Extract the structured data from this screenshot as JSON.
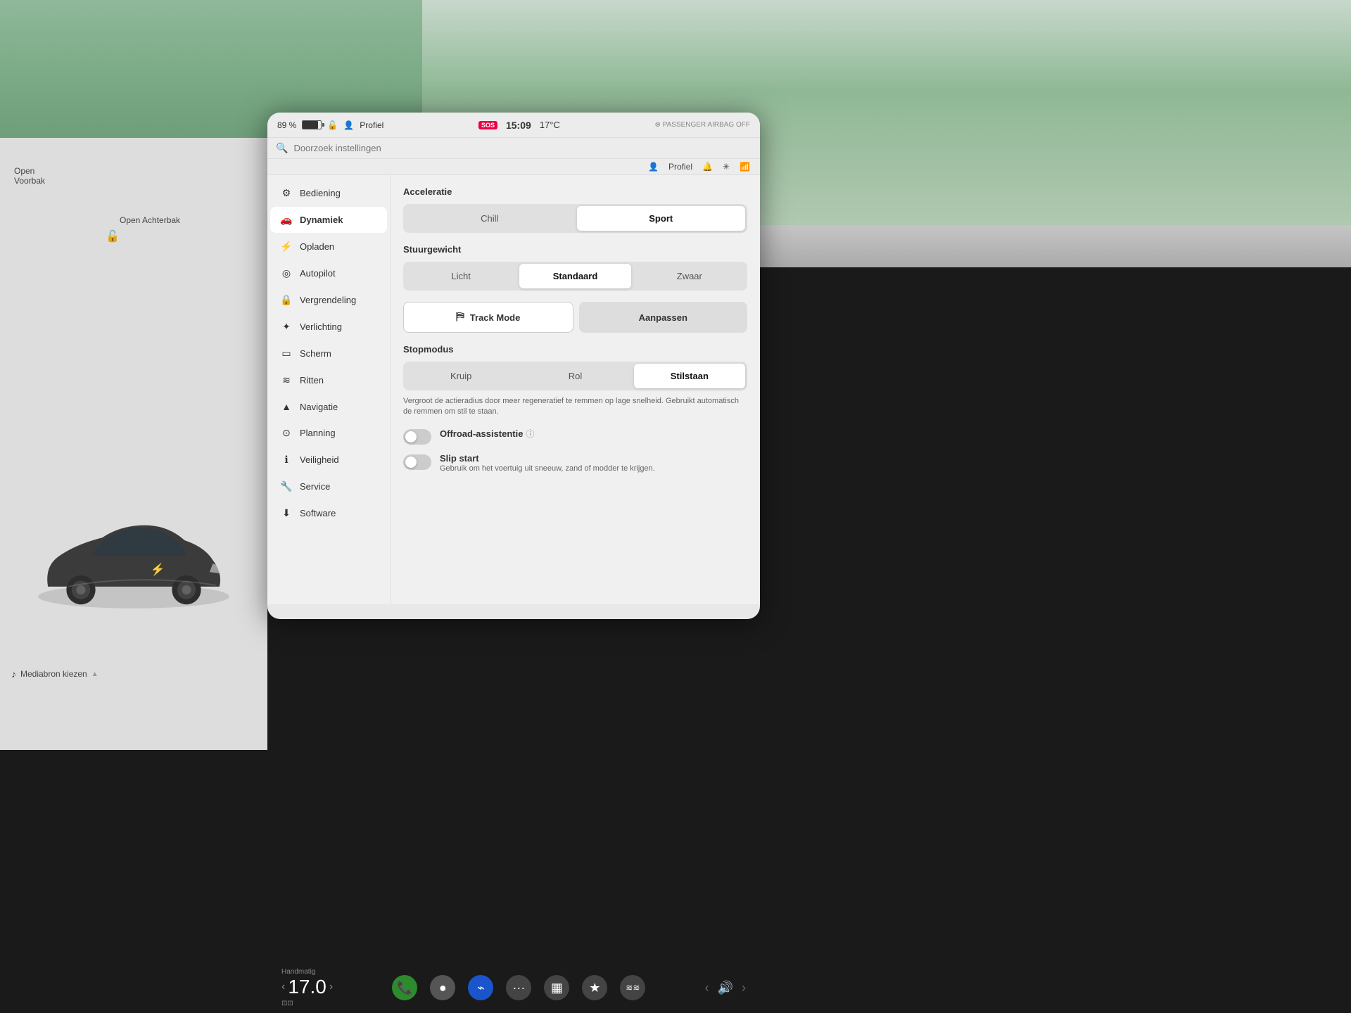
{
  "background": {
    "color": "#8fb89a"
  },
  "status_bar": {
    "battery_percent": "89 %",
    "profile_label": "Profiel",
    "sos_label": "SOS",
    "time": "15:09",
    "temperature": "17°C"
  },
  "search": {
    "placeholder": "Doorzoek instellingen"
  },
  "profile_bar": {
    "profile_label": "Profiel"
  },
  "sidebar": {
    "items": [
      {
        "id": "bediening",
        "label": "Bediening",
        "icon": "⚙"
      },
      {
        "id": "dynamiek",
        "label": "Dynamiek",
        "icon": "🚗",
        "active": true
      },
      {
        "id": "opladen",
        "label": "Opladen",
        "icon": "⚡"
      },
      {
        "id": "autopilot",
        "label": "Autopilot",
        "icon": "◎"
      },
      {
        "id": "vergrendeling",
        "label": "Vergrendeling",
        "icon": "🔒"
      },
      {
        "id": "verlichting",
        "label": "Verlichting",
        "icon": "✦"
      },
      {
        "id": "scherm",
        "label": "Scherm",
        "icon": "▭"
      },
      {
        "id": "ritten",
        "label": "Ritten",
        "icon": "≋"
      },
      {
        "id": "navigatie",
        "label": "Navigatie",
        "icon": "▲"
      },
      {
        "id": "planning",
        "label": "Planning",
        "icon": "⊙"
      },
      {
        "id": "veiligheid",
        "label": "Veiligheid",
        "icon": "ℹ"
      },
      {
        "id": "service",
        "label": "Service",
        "icon": "🔧"
      },
      {
        "id": "software",
        "label": "Software",
        "icon": "⬇"
      }
    ]
  },
  "settings": {
    "acceleratie": {
      "title": "Acceleratie",
      "options": [
        {
          "id": "chill",
          "label": "Chill",
          "active": false
        },
        {
          "id": "sport",
          "label": "Sport",
          "active": true
        }
      ]
    },
    "stuurgewicht": {
      "title": "Stuurgewicht",
      "options": [
        {
          "id": "licht",
          "label": "Licht",
          "active": false
        },
        {
          "id": "standaard",
          "label": "Standaard",
          "active": true
        },
        {
          "id": "zwaar",
          "label": "Zwaar",
          "active": false
        }
      ]
    },
    "track_mode": {
      "label": "Track Mode",
      "adjust_label": "Aanpassen"
    },
    "stopmodus": {
      "title": "Stopmodus",
      "options": [
        {
          "id": "kruip",
          "label": "Kruip",
          "active": false
        },
        {
          "id": "rol",
          "label": "Rol",
          "active": false
        },
        {
          "id": "stilstaan",
          "label": "Stilstaan",
          "active": true
        }
      ],
      "description": "Vergroot de actieradius door meer regeneratief te remmen op lage snelheid. Gebruikt automatisch de remmen om stil te staan."
    },
    "offroad": {
      "label": "Offroad-assistentie",
      "enabled": false
    },
    "slip_start": {
      "label": "Slip start",
      "description": "Gebruik om het voertuig uit sneeuw, zand of modder te krijgen.",
      "enabled": false
    }
  },
  "car_panel": {
    "open_voorbak": "Open\nVoorbak",
    "open_achterbak": "Open\nAchterbak"
  },
  "taskbar": {
    "handmatig": "Handmatig",
    "temperature": "17.0",
    "media_label": "Mediabron kiezen",
    "icons": [
      "phone",
      "camera",
      "bluetooth",
      "dots",
      "chart",
      "star",
      "tidal"
    ]
  }
}
